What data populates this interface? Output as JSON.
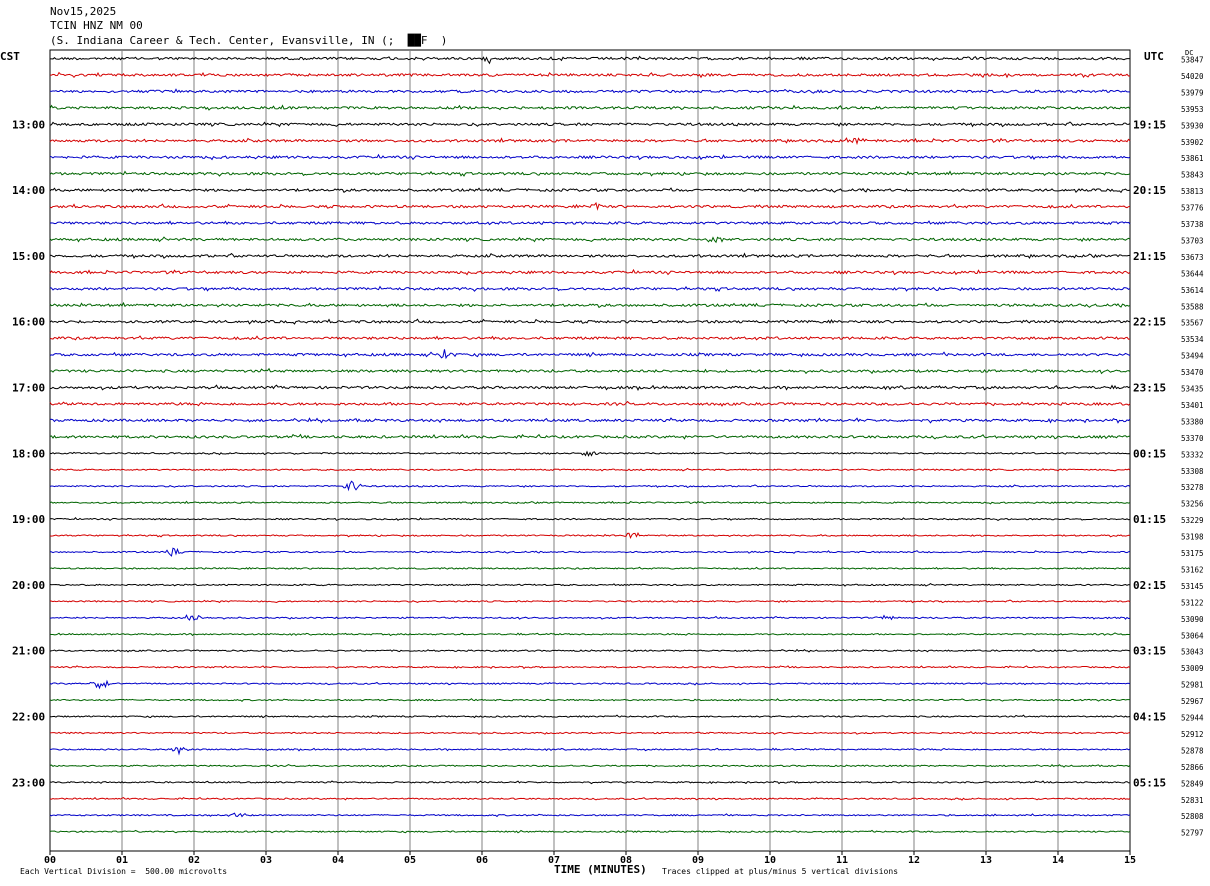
{
  "header": {
    "date": "Nov15,2025",
    "station": "TCIN HNZ NM 00",
    "location": "(S. Indiana Career & Tech. Center, Evansville, IN (;  ██F  )"
  },
  "left_tz": "CST",
  "right_tz": "UTC",
  "dc_label": "DC",
  "footer": {
    "scale": "Each Vertical Division =  500.00 microvolts",
    "clip": "Traces clipped at plus/minus 5 vertical divisions"
  },
  "colors": {
    "trace_cycle": [
      "#000000",
      "#d40000",
      "#0000c8",
      "#006400"
    ],
    "grid": "#808080"
  },
  "chart_data": {
    "type": "line",
    "title": "TCIN HNZ NM 00",
    "xlabel": "TIME (MINUTES)",
    "x_ticks": [
      "00",
      "01",
      "02",
      "03",
      "04",
      "05",
      "06",
      "07",
      "08",
      "09",
      "10",
      "11",
      "12",
      "13",
      "14",
      "15"
    ],
    "xlim": [
      0,
      15
    ],
    "left_hour_labels": [
      "13:00",
      "14:00",
      "15:00",
      "16:00",
      "17:00",
      "18:00",
      "19:00",
      "20:00",
      "21:00",
      "22:00",
      "23:00"
    ],
    "right_hour_labels": [
      "19:15",
      "20:15",
      "21:15",
      "22:15",
      "23:15",
      "00:15",
      "01:15",
      "02:15",
      "03:15",
      "04:15",
      "05:15"
    ],
    "hour_label_row_start": 4,
    "dc_offsets": [
      53847,
      54020,
      53979,
      53953,
      53930,
      53902,
      53861,
      53843,
      53813,
      53776,
      53738,
      53703,
      53673,
      53644,
      53614,
      53588,
      53567,
      53534,
      53494,
      53470,
      53435,
      53401,
      53380,
      53370,
      53332,
      53308,
      53278,
      53256,
      53229,
      53198,
      53175,
      53162,
      53145,
      53122,
      53090,
      53064,
      53043,
      53009,
      52981,
      52967,
      52944,
      52912,
      52878,
      52866,
      52849,
      52831,
      52808,
      52797
    ],
    "events": [
      {
        "row": 0,
        "minute": 6.1,
        "amp": 3
      },
      {
        "row": 5,
        "minute": 11.2,
        "amp": 3
      },
      {
        "row": 9,
        "minute": 7.6,
        "amp": 3
      },
      {
        "row": 11,
        "minute": 9.2,
        "amp": 3
      },
      {
        "row": 18,
        "minute": 5.5,
        "amp": 6
      },
      {
        "row": 24,
        "minute": 7.5,
        "amp": 4
      },
      {
        "row": 26,
        "minute": 4.2,
        "amp": 6
      },
      {
        "row": 29,
        "minute": 8.1,
        "amp": 4
      },
      {
        "row": 30,
        "minute": 1.7,
        "amp": 4
      },
      {
        "row": 34,
        "minute": 2.0,
        "amp": 4
      },
      {
        "row": 34,
        "minute": 11.6,
        "amp": 3
      },
      {
        "row": 38,
        "minute": 0.7,
        "amp": 5
      },
      {
        "row": 42,
        "minute": 1.8,
        "amp": 4
      },
      {
        "row": 46,
        "minute": 2.6,
        "amp": 4
      }
    ]
  }
}
